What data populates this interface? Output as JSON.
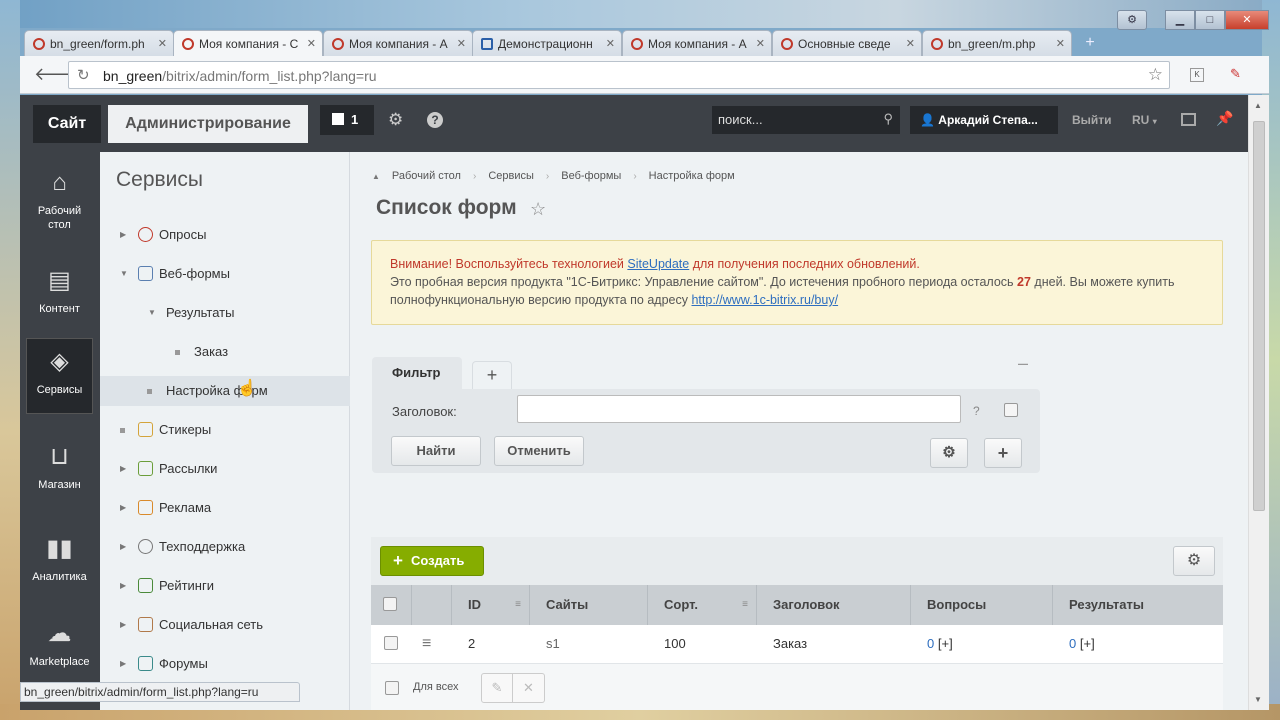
{
  "browser": {
    "tabs": [
      {
        "title": "bn_green/form.ph",
        "active": false
      },
      {
        "title": "Моя компания - С",
        "active": true
      },
      {
        "title": "Моя компания - А",
        "active": false
      },
      {
        "title": "Демонстрационн",
        "active": false
      },
      {
        "title": "Моя компания - А",
        "active": false
      },
      {
        "title": "Основные сведе",
        "active": false
      },
      {
        "title": "bn_green/m.php",
        "active": false
      }
    ],
    "url_host": "bn_green",
    "url_path": "/bitrix/admin/form_list.php?lang=ru",
    "status_url": "bn_green/bitrix/admin/form_list.php?lang=ru"
  },
  "adminbar": {
    "site": "Сайт",
    "admin": "Администрирование",
    "notifications": "1",
    "search_placeholder": "поиск...",
    "user": "Аркадий Степа...",
    "exit": "Выйти",
    "lang": "RU"
  },
  "leftmenu": [
    {
      "label": "Рабочий стол",
      "icon": "home-icon"
    },
    {
      "label": "Контент",
      "icon": "document-icon"
    },
    {
      "label": "Сервисы",
      "icon": "layers-icon"
    },
    {
      "label": "Магазин",
      "icon": "basket-icon"
    },
    {
      "label": "Аналитика",
      "icon": "bar-chart-icon"
    },
    {
      "label": "Marketplace",
      "icon": "cloud-download-icon"
    }
  ],
  "submenu": {
    "title": "Сервисы",
    "items": [
      {
        "label": "Опросы"
      },
      {
        "label": "Веб-формы"
      },
      {
        "label": "Результаты"
      },
      {
        "label": "Заказ"
      },
      {
        "label": "Настройка форм"
      },
      {
        "label": "Стикеры"
      },
      {
        "label": "Рассылки"
      },
      {
        "label": "Реклама"
      },
      {
        "label": "Техподдержка"
      },
      {
        "label": "Рейтинги"
      },
      {
        "label": "Социальная сеть"
      },
      {
        "label": "Форумы"
      }
    ]
  },
  "breadcrumbs": [
    "Рабочий стол",
    "Сервисы",
    "Веб-формы",
    "Настройка форм"
  ],
  "page_title": "Список форм",
  "alert": {
    "warn_prefix": "Внимание! Воспользуйтесь технологией ",
    "link1": "SiteUpdate",
    "warn_suffix": " для получения последних обновлений.",
    "line2_start": "Это пробная версия продукта \"1С-Битрикс: Управление сайтом\". До истечения пробного периода осталось ",
    "days": "27",
    "line2_end": " дней. Вы можете купить полнофункциональную версию продукта по адресу ",
    "link2": "http://www.1c-bitrix.ru/buy/"
  },
  "filter": {
    "tab": "Фильтр",
    "field_label": "Заголовок:",
    "field_value": "",
    "help": "?",
    "find": "Найти",
    "cancel": "Отменить"
  },
  "grid": {
    "create": "Создать",
    "columns": [
      "ID",
      "Сайты",
      "Сорт.",
      "Заголовок",
      "Вопросы",
      "Результаты"
    ],
    "rows": [
      {
        "id": "2",
        "sites": "s1",
        "sort": "100",
        "title": "Заказ",
        "questions": "0",
        "questions_add": "[+]",
        "results": "0",
        "results_add": "[+]"
      }
    ],
    "for_all": "Для всех"
  }
}
